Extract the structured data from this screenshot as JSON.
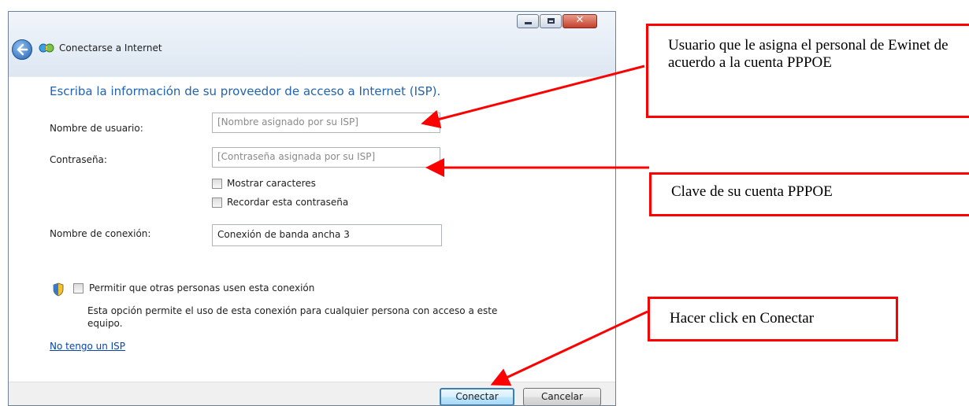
{
  "window": {
    "title": "Conectarse a Internet",
    "controls": {
      "minimize_icon": "minimize-icon",
      "maximize_icon": "maximize-icon",
      "close_glyph": "✕"
    }
  },
  "heading": "Escriba la información de su proveedor de acceso a Internet (ISP).",
  "form": {
    "username_label": "Nombre de usuario:",
    "username_placeholder": "[Nombre asignado por su ISP]",
    "password_label": "Contraseña:",
    "password_placeholder": "[Contraseña asignada por su ISP]",
    "show_chars_label": "Mostrar caracteres",
    "show_chars_checked": false,
    "remember_label": "Recordar esta contraseña",
    "remember_checked": false,
    "connection_label": "Nombre de conexión:",
    "connection_value": "Conexión de banda ancha 3",
    "allow_others_label": "Permitir que otras personas usen esta conexión",
    "allow_others_checked": false,
    "allow_others_desc": "Esta opción permite el uso de esta conexión para cualquier persona con acceso a este equipo."
  },
  "link_no_isp": "No tengo un ISP",
  "buttons": {
    "connect": "Conectar",
    "cancel": "Cancelar"
  },
  "annotations": {
    "username_note": "Usuario que le asigna el personal de Ewinet de acuerdo a la cuenta PPPOE",
    "password_note": "Clave de su cuenta PPPOE",
    "connect_note": "Hacer click en Conectar"
  },
  "colors": {
    "annotation": "#ff0000",
    "heading": "#2163b0",
    "link": "#0645ad"
  }
}
